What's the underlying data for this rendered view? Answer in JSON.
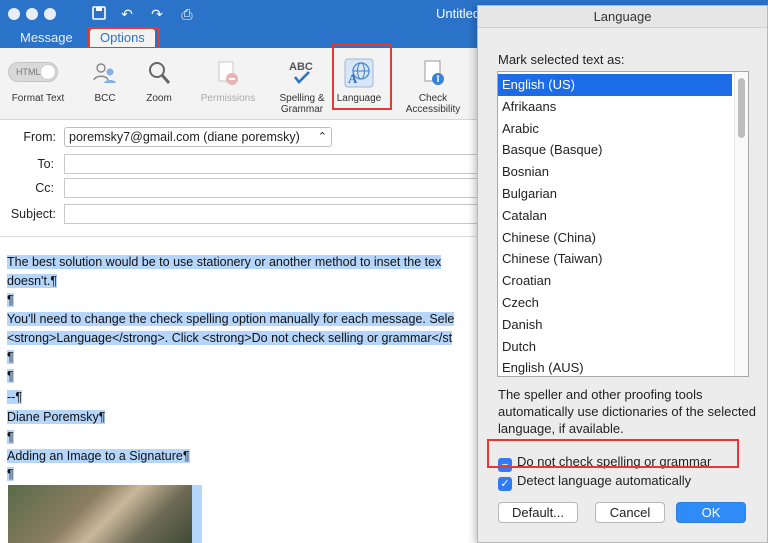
{
  "window": {
    "title": "Untitled"
  },
  "tabs": [
    {
      "label": "Message"
    },
    {
      "label": "Options"
    }
  ],
  "ribbon": {
    "format_toggle": "HTML",
    "format_text": "Format Text",
    "bcc": "BCC",
    "zoom": "Zoom",
    "permissions": "Permissions",
    "spelling_l1": "Spelling &",
    "spelling_l2": "Grammar",
    "language": "Language",
    "check_l1": "Check",
    "check_l2": "Accessibility"
  },
  "header": {
    "from_label": "From:",
    "from_value": "poremsky7@gmail.com (diane poremsky)",
    "to_label": "To:",
    "cc_label": "Cc:",
    "subject_label": "Subject:"
  },
  "body": {
    "l1": "The best solution would be to use stationery or another method to inset the tex",
    "l2": "doesn't.¶",
    "l3": "¶",
    "l4": "You'll need to change the check spelling option manually for each message. Sele",
    "l5": "<strong>Language</strong>. Click <strong>Do not check selling or grammar</st",
    "l6": "¶",
    "l7": "¶",
    "l8": "--¶",
    "l9": "Diane Poremsky¶",
    "l10": "¶",
    "l11": "Adding an Image to a Signature¶",
    "l12": "¶"
  },
  "dialog": {
    "title": "Language",
    "mark_label": "Mark selected text as:",
    "languages": [
      "English (US)",
      "Afrikaans",
      "Arabic",
      "Basque (Basque)",
      "Bosnian",
      "Bulgarian",
      "Catalan",
      "Chinese (China)",
      "Chinese (Taiwan)",
      "Croatian",
      "Czech",
      "Danish",
      "Dutch",
      "English (AUS)"
    ],
    "selected": "English (US)",
    "info": "The speller and other proofing tools automatically use dictionaries of the selected language, if available.",
    "do_not_check": "Do not check spelling or grammar",
    "detect": "Detect language automatically",
    "default_btn": "Default...",
    "cancel_btn": "Cancel",
    "ok_btn": "OK"
  },
  "colors": {
    "accent": "#2b73c9",
    "highlight": "#b5d5fb",
    "callout": "#e53935",
    "selection": "#1b6ce6"
  }
}
